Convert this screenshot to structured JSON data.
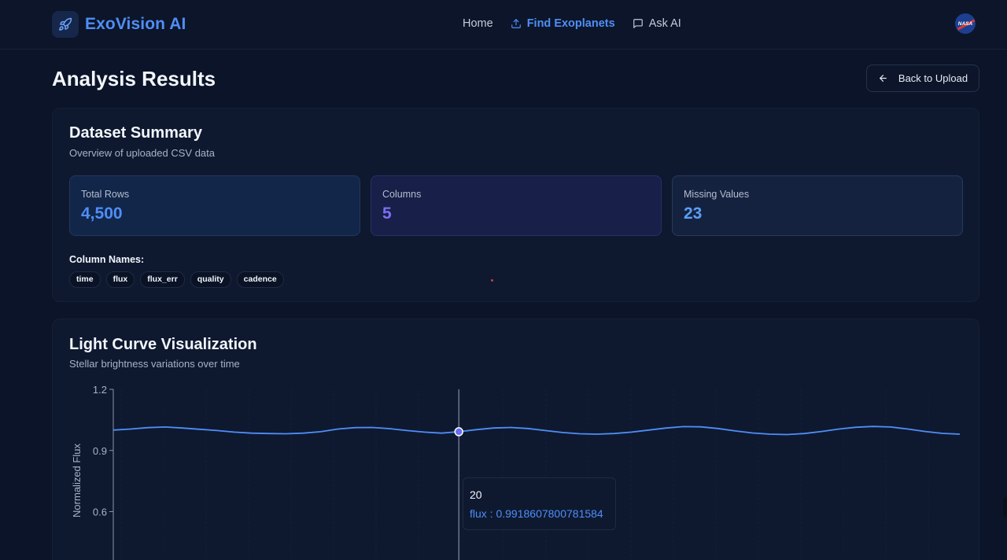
{
  "header": {
    "brand": "ExoVision AI",
    "nav": [
      {
        "label": "Home",
        "icon": "none",
        "active": false
      },
      {
        "label": "Find Exoplanets",
        "icon": "upload-icon",
        "active": true
      },
      {
        "label": "Ask AI",
        "icon": "chat-icon",
        "active": false
      }
    ],
    "nasa_logo": "NASA"
  },
  "page": {
    "title": "Analysis Results",
    "back_label": "Back to Upload"
  },
  "summary": {
    "title": "Dataset Summary",
    "subtitle": "Overview of uploaded CSV data",
    "stats": [
      {
        "label": "Total Rows",
        "value": "4,500"
      },
      {
        "label": "Columns",
        "value": "5"
      },
      {
        "label": "Missing Values",
        "value": "23"
      }
    ],
    "columns_label": "Column Names:",
    "columns": [
      "time",
      "flux",
      "flux_err",
      "quality",
      "cadence"
    ]
  },
  "viz": {
    "title": "Light Curve Visualization",
    "subtitle": "Stellar brightness variations over time"
  },
  "chart_data": {
    "type": "line",
    "ylabel": "Normalized Flux",
    "yticks": [
      "1.2",
      "0.9",
      "0.6"
    ],
    "ylim": [
      0,
      1.2
    ],
    "series": [
      {
        "name": "flux",
        "color": "#4f8ef7",
        "x": [
          0,
          1,
          2,
          3,
          4,
          5,
          6,
          7,
          8,
          9,
          10,
          11,
          12,
          13,
          14,
          15,
          16,
          17,
          18,
          19,
          20,
          21,
          22,
          23,
          24,
          25,
          26,
          27,
          28,
          29,
          30,
          31,
          32,
          33,
          34,
          35,
          36,
          37,
          38,
          39,
          40,
          41,
          42,
          43,
          44,
          45,
          46,
          47,
          48,
          49
        ],
        "values": [
          1.0,
          1.005,
          1.012,
          1.015,
          1.01,
          1.004,
          0.998,
          0.99,
          0.985,
          0.983,
          0.982,
          0.985,
          0.992,
          1.005,
          1.012,
          1.013,
          1.007,
          0.998,
          0.99,
          0.985,
          0.9919,
          1.002,
          1.01,
          1.013,
          1.008,
          0.998,
          0.988,
          0.982,
          0.98,
          0.983,
          0.99,
          1.0,
          1.01,
          1.017,
          1.016,
          1.008,
          0.996,
          0.986,
          0.98,
          0.978,
          0.983,
          0.993,
          1.005,
          1.014,
          1.018,
          1.015,
          1.005,
          0.993,
          0.984,
          0.98
        ]
      }
    ],
    "tooltip": {
      "x": "20",
      "series": "flux",
      "value": "0.9918607800781584"
    },
    "cursor_index": 20
  }
}
